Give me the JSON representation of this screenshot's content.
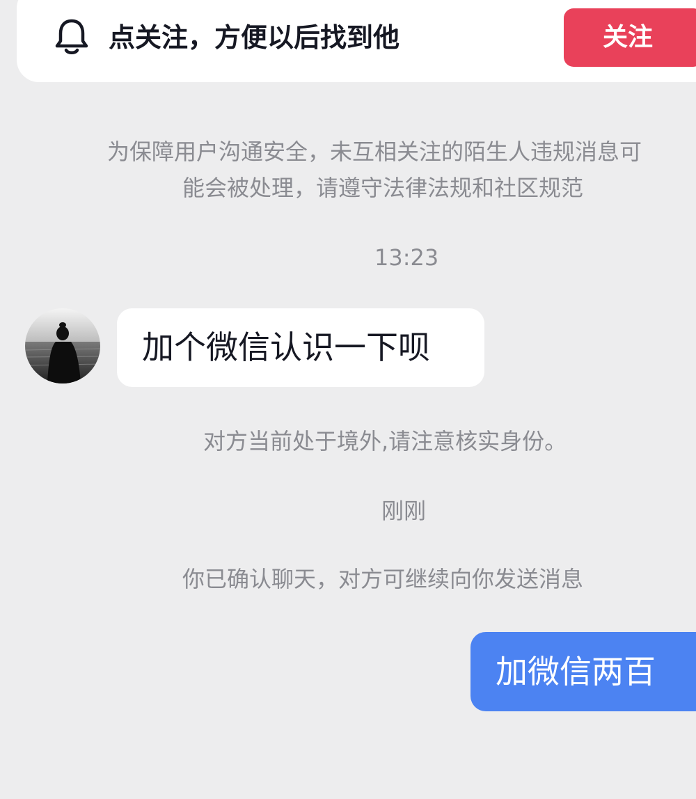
{
  "banner": {
    "icon": "bell-icon",
    "text": "点关注，方便以后找到他",
    "follow_label": "关注",
    "follow_color": "#e9415a"
  },
  "system": {
    "safety_line_1": "为保障用户沟通安全，未互相关注的陌生人违规消息可",
    "safety_line_2": "能会被处理，请遵守法律法规和社区规范",
    "overseas_note": "对方当前处于境外,请注意核实身份。",
    "confirm_note": "你已确认聊天，对方可继续向你发送消息"
  },
  "timestamps": {
    "first": "13:23",
    "second": "刚刚"
  },
  "messages": {
    "incoming": {
      "text": "加个微信认识一下呗",
      "avatar_icon": "avatar-silhouette"
    },
    "outgoing": {
      "text": "加微信两百",
      "bubble_color": "#4c83f2"
    }
  }
}
